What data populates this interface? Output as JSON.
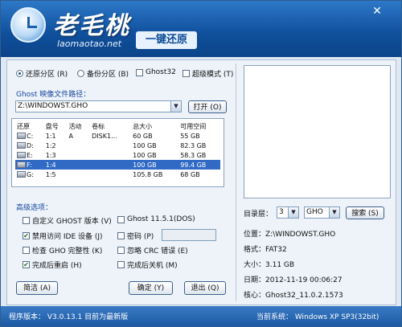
{
  "header": {
    "brand": "老毛桃",
    "domain": "laomaotao.net",
    "tagline": "一键还原",
    "close_glyph": "✕"
  },
  "mode": {
    "restore": "还原分区 (R)",
    "backup": "备份分区 (B)",
    "ghost32": "Ghost32",
    "expert": "超级模式 (T)"
  },
  "image_path": {
    "label": "Ghost 映像文件路径：",
    "value": "Z:\\WINDOWST.GHO",
    "open_button": "打开 (O)"
  },
  "partition_table": {
    "columns": [
      "还原",
      "盘号",
      "活动",
      "卷标",
      "总大小",
      "可用空间"
    ],
    "rows": [
      {
        "drive": "C:",
        "disk": "1:1",
        "active": "A",
        "label": "DISK1...",
        "total": "60 GB",
        "free": "55 GB",
        "selected": false
      },
      {
        "drive": "D:",
        "disk": "1:2",
        "active": "",
        "label": "",
        "total": "100 GB",
        "free": "82.3 GB",
        "selected": false
      },
      {
        "drive": "E:",
        "disk": "1:3",
        "active": "",
        "label": "",
        "total": "100 GB",
        "free": "58.3 GB",
        "selected": false
      },
      {
        "drive": "F:",
        "disk": "1:4",
        "active": "",
        "label": "",
        "total": "100 GB",
        "free": "99.4 GB",
        "selected": true
      },
      {
        "drive": "G:",
        "disk": "1:5",
        "active": "",
        "label": "",
        "total": "105.8 GB",
        "free": "68 GB",
        "selected": false
      }
    ]
  },
  "advanced": {
    "title": "高级选项：",
    "custom_ghost": "自定义 GHOST 版本 (V)",
    "ghost_version": "Ghost 11.5.1(DOS)",
    "disable_ide": "禁用访问 IDE 设备 (J)",
    "password": "密码 (P)",
    "check_gho": "检查 GHO 完整性 (K)",
    "ignore_crc": "忽略 CRC 错误 (E)",
    "restart": "完成后重启 (H)",
    "shutdown": "完成后关机 (M)"
  },
  "buttons": {
    "simple": "简洁 (A)",
    "ok": "确定 (Y)",
    "exit": "退出 (Q)"
  },
  "right_panel": {
    "dir_label": "目录层：",
    "dir_value": "3",
    "ext_value": "GHO",
    "search_button": "搜索 (S)",
    "location": "位置：Z:\\WINDOWST.GHO",
    "format": "格式：FAT32",
    "size": "大小：3.11 GB",
    "date": "日期：2012-11-19   00:06:27",
    "core": "核心：Ghost32_11.0.2.1573"
  },
  "status": {
    "version": "程序版本： V3.0.13.1   目前为最新版",
    "system": "当前系统： Windows XP SP3(32bit)"
  }
}
